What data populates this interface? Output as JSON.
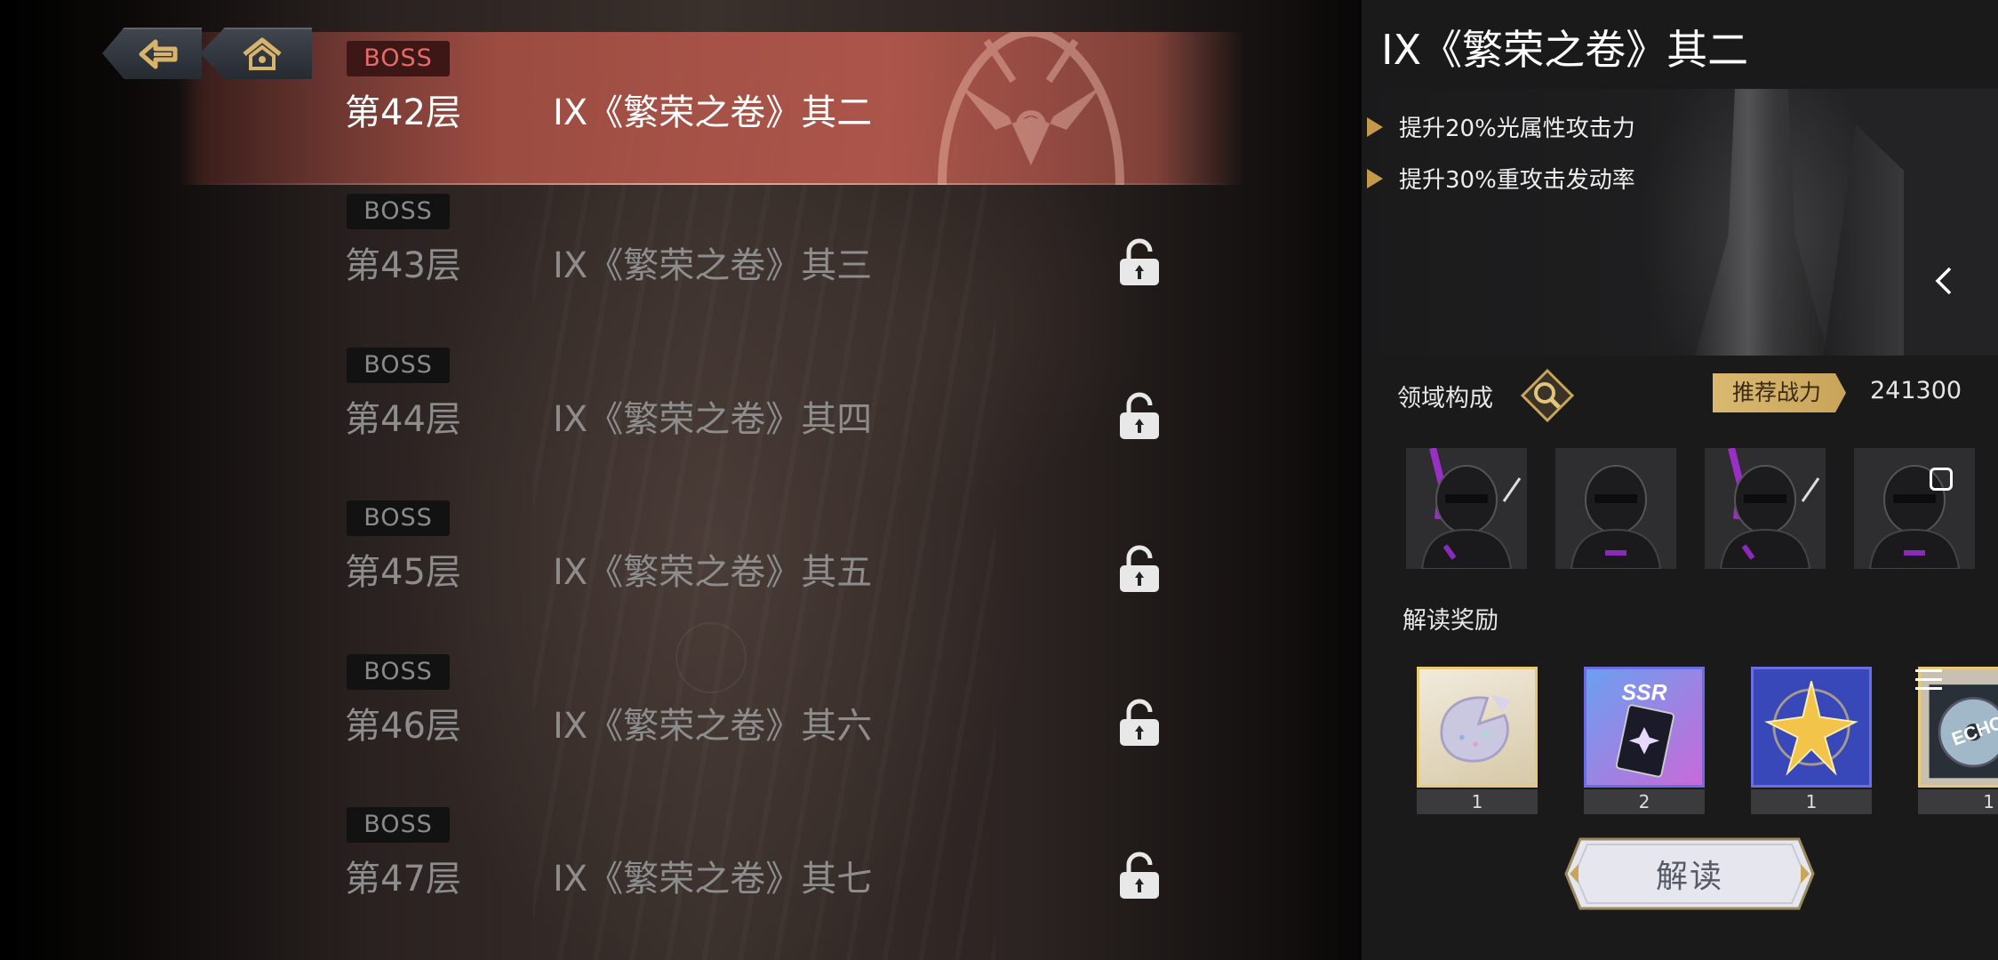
{
  "nav": {
    "back_icon": "back-arrow-icon",
    "home_icon": "home-icon"
  },
  "floors": [
    {
      "badge": "BOSS",
      "floor": "第42层",
      "title": "IX《繁荣之卷》其二",
      "locked": false,
      "active": true
    },
    {
      "badge": "BOSS",
      "floor": "第43层",
      "title": "IX《繁荣之卷》其三",
      "locked": true,
      "active": false
    },
    {
      "badge": "BOSS",
      "floor": "第44层",
      "title": "IX《繁荣之卷》其四",
      "locked": true,
      "active": false
    },
    {
      "badge": "BOSS",
      "floor": "第45层",
      "title": "IX《繁荣之卷》其五",
      "locked": true,
      "active": false
    },
    {
      "badge": "BOSS",
      "floor": "第46层",
      "title": "IX《繁荣之卷》其六",
      "locked": true,
      "active": false
    },
    {
      "badge": "BOSS",
      "floor": "第47层",
      "title": "IX《繁荣之卷》其七",
      "locked": true,
      "active": false
    }
  ],
  "detail": {
    "title": "IX《繁荣之卷》其二",
    "buffs": [
      "提升20%光属性攻击力",
      "提升30%重攻击发动率"
    ],
    "domain_label": "领域构成",
    "recommend_label": "推荐战力",
    "recommend_value": "241300",
    "reward_label": "解读奖励",
    "rewards": [
      {
        "icon": "holographic-shard-icon",
        "count": "1",
        "gold": true
      },
      {
        "icon": "ssr-card-icon",
        "count": "2",
        "gold": false
      },
      {
        "icon": "gold-star-icon",
        "count": "1",
        "gold": false
      },
      {
        "icon": "echo-disc-icon",
        "count": "1",
        "gold": true
      }
    ],
    "decode_button": "解读"
  },
  "colors": {
    "accent_gold": "#d9b970",
    "active_row": "#b95a4e",
    "boss_red": "#e86a6a"
  }
}
